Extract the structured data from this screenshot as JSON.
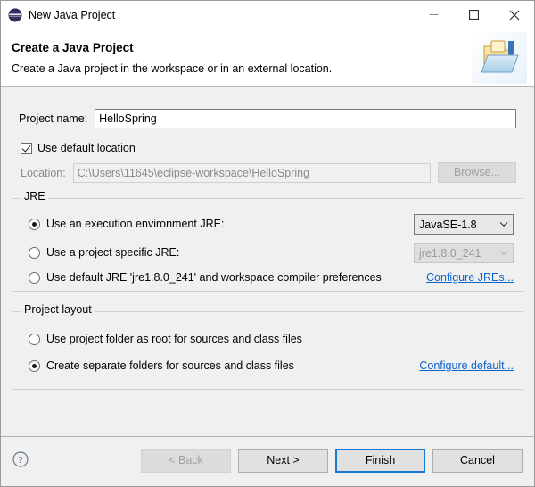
{
  "window": {
    "title": "New Java Project",
    "icon": "eclipse-wizard-icon",
    "controls": {
      "minimize": "minimize-icon",
      "maximize": "maximize-icon",
      "close": "close-icon"
    }
  },
  "header": {
    "title": "Create a Java Project",
    "description": "Create a Java project in the workspace or in an external location.",
    "banner_icon": "java-project-folder-icon"
  },
  "form": {
    "project_name_label": "Project name:",
    "project_name_value": "HelloSpring",
    "project_name_placeholder": "",
    "use_default_location_label": "Use default location",
    "use_default_location_checked": true,
    "location_label": "Location:",
    "location_value": "C:\\Users\\11645\\eclipse-workspace\\HelloSpring",
    "browse_label": "Browse...",
    "browse_enabled": false
  },
  "jre": {
    "group_label": "JRE",
    "options": [
      {
        "label": "Use an execution environment JRE:",
        "selected": true,
        "combo_value": "JavaSE-1.8",
        "combo_enabled": true
      },
      {
        "label": "Use a project specific JRE:",
        "selected": false,
        "combo_value": "jre1.8.0_241",
        "combo_enabled": false
      },
      {
        "label": "Use default JRE 'jre1.8.0_241' and workspace compiler preferences",
        "selected": false
      }
    ],
    "configure_link": "Configure JREs..."
  },
  "project_layout": {
    "group_label": "Project layout",
    "options": [
      {
        "label": "Use project folder as root for sources and class files",
        "selected": false
      },
      {
        "label": "Create separate folders for sources and class files",
        "selected": true
      }
    ],
    "configure_link": "Configure default..."
  },
  "footer": {
    "help_icon": "help-question-icon",
    "buttons": [
      {
        "label": "< Back",
        "enabled": false,
        "default": false
      },
      {
        "label": "Next >",
        "enabled": true,
        "default": false
      },
      {
        "label": "Finish",
        "enabled": true,
        "default": true
      },
      {
        "label": "Cancel",
        "enabled": true,
        "default": false
      }
    ]
  },
  "colors": {
    "accent": "#1878d4",
    "link": "#0b63ce",
    "body_background": "#f0f0f0",
    "header_background": "#ffffff"
  }
}
